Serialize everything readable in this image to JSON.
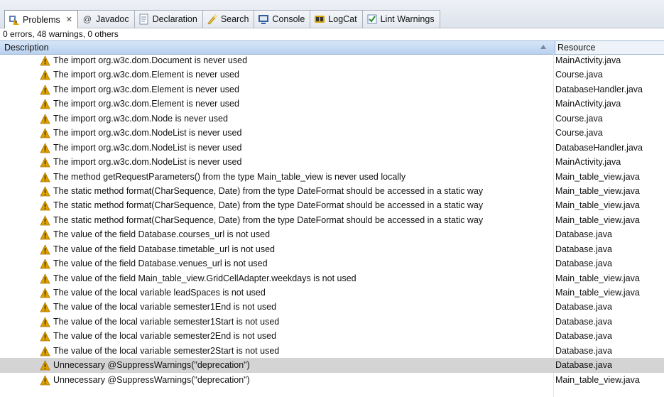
{
  "tabs": [
    {
      "label": "Problems",
      "icon": "problems-icon",
      "active": true
    },
    {
      "label": "Javadoc",
      "icon": "javadoc-icon"
    },
    {
      "label": "Declaration",
      "icon": "declaration-icon"
    },
    {
      "label": "Search",
      "icon": "search-icon"
    },
    {
      "label": "Console",
      "icon": "console-icon"
    },
    {
      "label": "LogCat",
      "icon": "logcat-icon"
    },
    {
      "label": "Lint Warnings",
      "icon": "lint-checkbox-icon"
    }
  ],
  "close_glyph": "✕",
  "javadoc_glyph": "@",
  "summary": "0 errors, 48 warnings, 0 others",
  "columns": {
    "description": "Description",
    "resource": "Resource"
  },
  "rows": [
    {
      "description": "The import org.w3c.dom.Document is never used",
      "resource": "MainActivity.java"
    },
    {
      "description": "The import org.w3c.dom.Element is never used",
      "resource": "Course.java"
    },
    {
      "description": "The import org.w3c.dom.Element is never used",
      "resource": "DatabaseHandler.java"
    },
    {
      "description": "The import org.w3c.dom.Element is never used",
      "resource": "MainActivity.java"
    },
    {
      "description": "The import org.w3c.dom.Node is never used",
      "resource": "Course.java"
    },
    {
      "description": "The import org.w3c.dom.NodeList is never used",
      "resource": "Course.java"
    },
    {
      "description": "The import org.w3c.dom.NodeList is never used",
      "resource": "DatabaseHandler.java"
    },
    {
      "description": "The import org.w3c.dom.NodeList is never used",
      "resource": "MainActivity.java"
    },
    {
      "description": "The method getRequestParameters() from the type Main_table_view is never used locally",
      "resource": "Main_table_view.java"
    },
    {
      "description": "The static method format(CharSequence, Date) from the type DateFormat should be accessed in a static way",
      "resource": "Main_table_view.java"
    },
    {
      "description": "The static method format(CharSequence, Date) from the type DateFormat should be accessed in a static way",
      "resource": "Main_table_view.java"
    },
    {
      "description": "The static method format(CharSequence, Date) from the type DateFormat should be accessed in a static way",
      "resource": "Main_table_view.java"
    },
    {
      "description": "The value of the field Database.courses_url is not used",
      "resource": "Database.java"
    },
    {
      "description": "The value of the field Database.timetable_url is not used",
      "resource": "Database.java"
    },
    {
      "description": "The value of the field Database.venues_url is not used",
      "resource": "Database.java"
    },
    {
      "description": "The value of the field Main_table_view.GridCellAdapter.weekdays is not used",
      "resource": "Main_table_view.java"
    },
    {
      "description": "The value of the local variable leadSpaces is not used",
      "resource": "Main_table_view.java"
    },
    {
      "description": "The value of the local variable semester1End is not used",
      "resource": "Database.java"
    },
    {
      "description": "The value of the local variable semester1Start is not used",
      "resource": "Database.java"
    },
    {
      "description": "The value of the local variable semester2End is not used",
      "resource": "Database.java"
    },
    {
      "description": "The value of the local variable semester2Start is not used",
      "resource": "Database.java"
    },
    {
      "description": "Unnecessary @SuppressWarnings(\"deprecation\")",
      "resource": "Database.java",
      "selected": true
    },
    {
      "description": "Unnecessary @SuppressWarnings(\"deprecation\")",
      "resource": "Main_table_view.java"
    }
  ],
  "colors": {
    "warning": "#e0a100",
    "header": "#c6daf3",
    "selected": "#d4d4d4"
  }
}
